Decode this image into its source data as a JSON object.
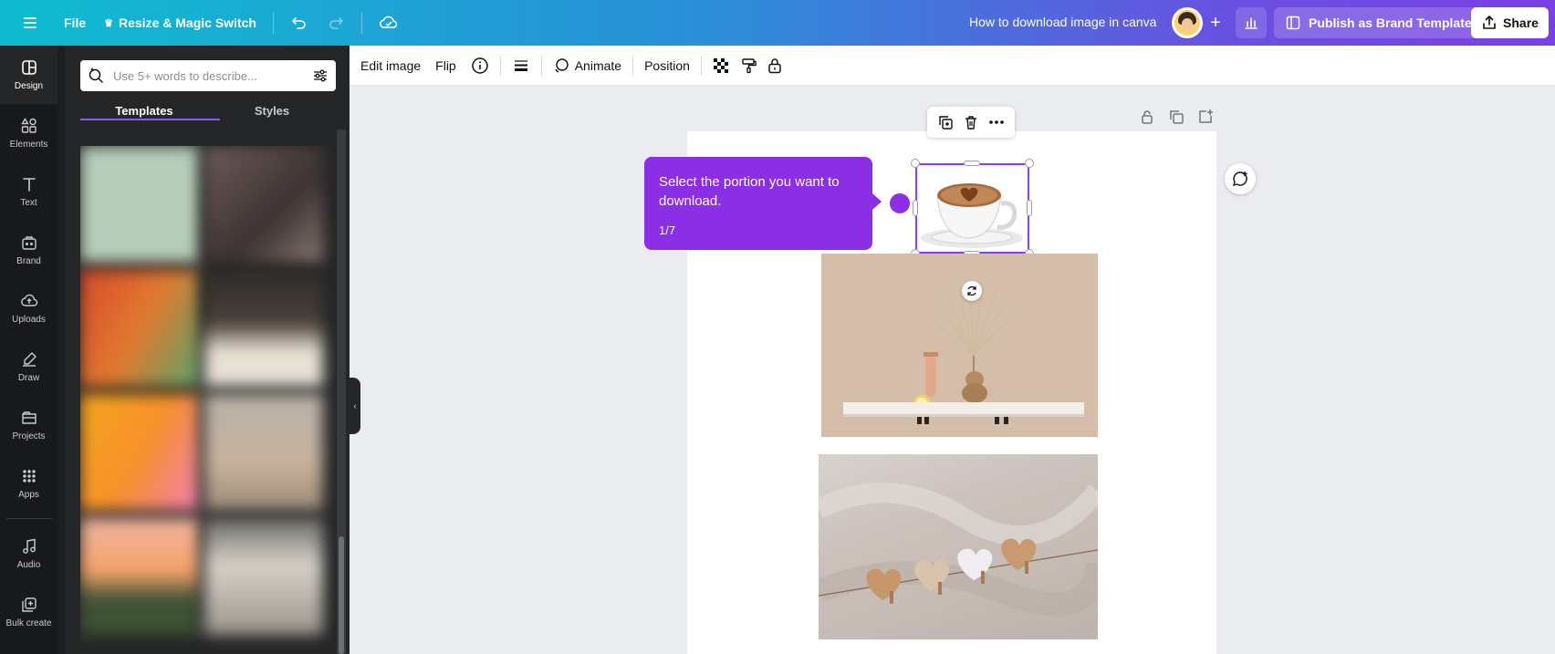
{
  "topbar": {
    "file_label": "File",
    "resize_label": "Resize & Magic Switch",
    "doc_title": "How to download image in canva",
    "publish_label": "Publish as Brand Template",
    "share_label": "Share"
  },
  "rail": {
    "items": [
      {
        "label": "Design",
        "icon": "design-icon"
      },
      {
        "label": "Elements",
        "icon": "elements-icon"
      },
      {
        "label": "Text",
        "icon": "text-icon"
      },
      {
        "label": "Brand",
        "icon": "brand-icon"
      },
      {
        "label": "Uploads",
        "icon": "uploads-icon"
      },
      {
        "label": "Draw",
        "icon": "draw-icon"
      },
      {
        "label": "Projects",
        "icon": "projects-icon"
      },
      {
        "label": "Apps",
        "icon": "apps-icon"
      },
      {
        "label": "Audio",
        "icon": "audio-icon"
      },
      {
        "label": "Bulk create",
        "icon": "bulk-create-icon"
      }
    ]
  },
  "panel": {
    "search_placeholder": "Use 5+ words to describe...",
    "tabs": [
      "Templates",
      "Styles"
    ]
  },
  "context_toolbar": {
    "edit_image": "Edit image",
    "flip": "Flip",
    "animate": "Animate",
    "position": "Position"
  },
  "tooltip": {
    "text": "Select the portion you want to download.",
    "count": "1/7"
  },
  "colors": {
    "accent": "#8b2fe6",
    "selection": "#8b3dff"
  }
}
